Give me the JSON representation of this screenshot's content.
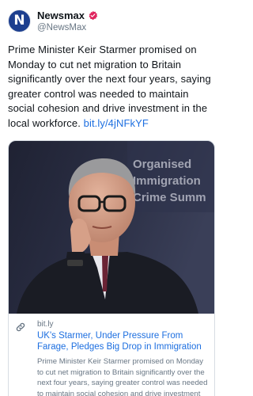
{
  "account": {
    "name": "Newsmax",
    "handle": "@NewsMax",
    "avatar_letter": "N"
  },
  "post": {
    "text": "Prime Minister Keir Starmer promised on Monday to cut net migration to Britain significantly over the next four years, saying greater control was needed to maintain social cohesion and drive investment in the local workforce.",
    "link_text": "bit.ly/4jNFkYF"
  },
  "card": {
    "background_sign_text": [
      "Organised",
      "Immigration",
      "Crime Summ"
    ],
    "domain": "bit.ly",
    "title": "UK's Starmer, Under Pressure From Farage, Pledges Big Drop in Immigration",
    "description": "Prime Minister Keir Starmer promised on Monday to cut net migration to Britain significantly over the next four years, saying greater control was needed to maintain social cohesion and drive investment in the local workforce. Controlling immigration was a key factor in..."
  },
  "icons": {
    "verified": "verified-badge-icon",
    "link": "link-icon"
  },
  "colors": {
    "link": "#1d6fe0",
    "verified": "#e0245e",
    "avatar_bg": "#1d3f8f"
  }
}
